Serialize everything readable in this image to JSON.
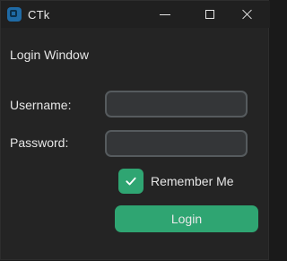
{
  "titlebar": {
    "app_title": "CTk",
    "icons": {
      "app": "app-icon",
      "minimize": "minimize-icon",
      "maximize": "maximize-icon",
      "close": "close-icon"
    }
  },
  "page": {
    "title": "Login Window"
  },
  "form": {
    "username_label": "Username:",
    "password_label": "Password:",
    "username_value": "",
    "password_value": "",
    "remember_label": "Remember Me",
    "remember_checked": true,
    "login_label": "Login"
  },
  "colors": {
    "window_bg": "#242424",
    "titlebar_bg": "#202020",
    "entry_bg": "#343638",
    "entry_border": "#565b5e",
    "accent_green": "#2fa572",
    "text": "#e6e6e6",
    "app_icon_blue": "#1f6aa5"
  }
}
